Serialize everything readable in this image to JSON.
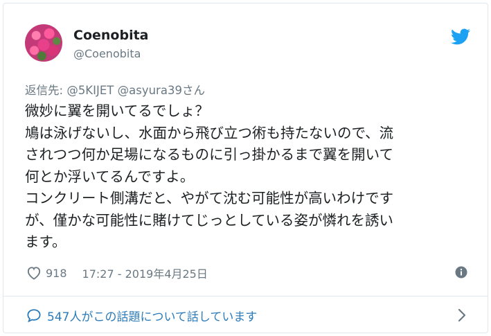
{
  "author": {
    "display_name": "Coenobita",
    "screen_name": "@Coenobita"
  },
  "reply": {
    "prefix": "返信先:",
    "mention_1": "@5KIJET",
    "mention_2": "@asyura39",
    "suffix": "さん"
  },
  "tweet": {
    "lines": [
      "微妙に翼を開いてるでしょ？",
      "鳩は泳げないし、水面から飛び立つ術も持たないので、流",
      "されつつ何か足場になるものに引っ掛かるまで翼を開いて",
      "何とか浮いてるんですよ。",
      "コンクリート側溝だと、やがて沈む可能性が高いわけです",
      "が、僅かな可能性に賭けてじっとしている姿が憐れを誘い",
      "ます。"
    ]
  },
  "meta": {
    "like_count": "918",
    "timestamp": "17:27 - 2019年4月25日"
  },
  "conversation": {
    "label": "547人がこの話題について話しています"
  },
  "icons": {
    "brand": "twitter-bird-icon",
    "like": "heart-icon",
    "info": "info-icon",
    "conversation": "speech-bubble-icon",
    "more": "chevron-right-icon"
  },
  "colors": {
    "twitter_blue": "#1da1f2",
    "link_blue": "#2b7bb9",
    "secondary_text": "#697882",
    "primary_text": "#1c2022",
    "border": "#e1e8ed"
  }
}
